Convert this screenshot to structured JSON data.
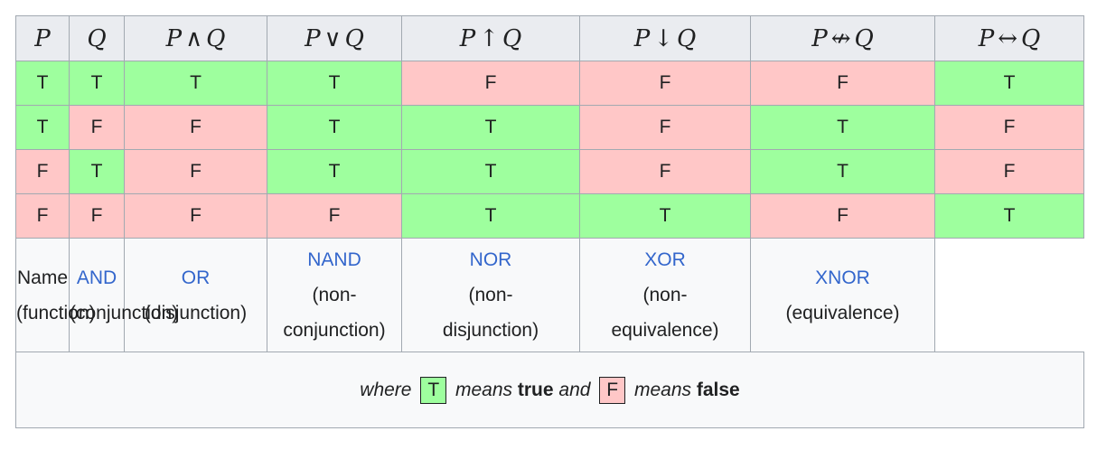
{
  "headers": [
    {
      "left": "P",
      "op": "",
      "right": ""
    },
    {
      "left": "Q",
      "op": "",
      "right": ""
    },
    {
      "left": "P",
      "op": "∧",
      "right": "Q"
    },
    {
      "left": "P",
      "op": "∨",
      "right": "Q"
    },
    {
      "left": "P",
      "op": "↑",
      "right": "Q"
    },
    {
      "left": "P",
      "op": "↓",
      "right": "Q"
    },
    {
      "left": "P",
      "op": "↮",
      "right": "Q"
    },
    {
      "left": "P",
      "op": "↔",
      "right": "Q"
    }
  ],
  "rows": [
    [
      "T",
      "T",
      "T",
      "T",
      "F",
      "F",
      "F",
      "T"
    ],
    [
      "T",
      "F",
      "F",
      "T",
      "T",
      "F",
      "T",
      "F"
    ],
    [
      "F",
      "T",
      "F",
      "T",
      "T",
      "F",
      "T",
      "F"
    ],
    [
      "F",
      "F",
      "F",
      "F",
      "T",
      "T",
      "F",
      "T"
    ]
  ],
  "names": {
    "c0": {
      "l1": "Name",
      "l2": "(function)"
    },
    "c1": {
      "link": "AND",
      "l2": "(conjunction)"
    },
    "c2": {
      "link": "OR",
      "l2": "(disjunction)"
    },
    "c3": {
      "link": "NAND",
      "l2": "(non-",
      "l3": "conjunction)"
    },
    "c4": {
      "link": "NOR",
      "l2": "(non-",
      "l3": "disjunction)"
    },
    "c5": {
      "link": "XOR",
      "l2": "(non-",
      "l3": "equivalence)"
    },
    "c6": {
      "link": "XNOR",
      "l2": "(equivalence)"
    }
  },
  "footer": {
    "where": "where",
    "t_key": "T",
    "means1": "means",
    "true_word": "true",
    "and_word": "and",
    "f_key": "F",
    "means2": "means",
    "false_word": "false"
  },
  "colors": {
    "true_bg": "#9eff9e",
    "false_bg": "#ffc7c7",
    "link": "#3366cc"
  }
}
